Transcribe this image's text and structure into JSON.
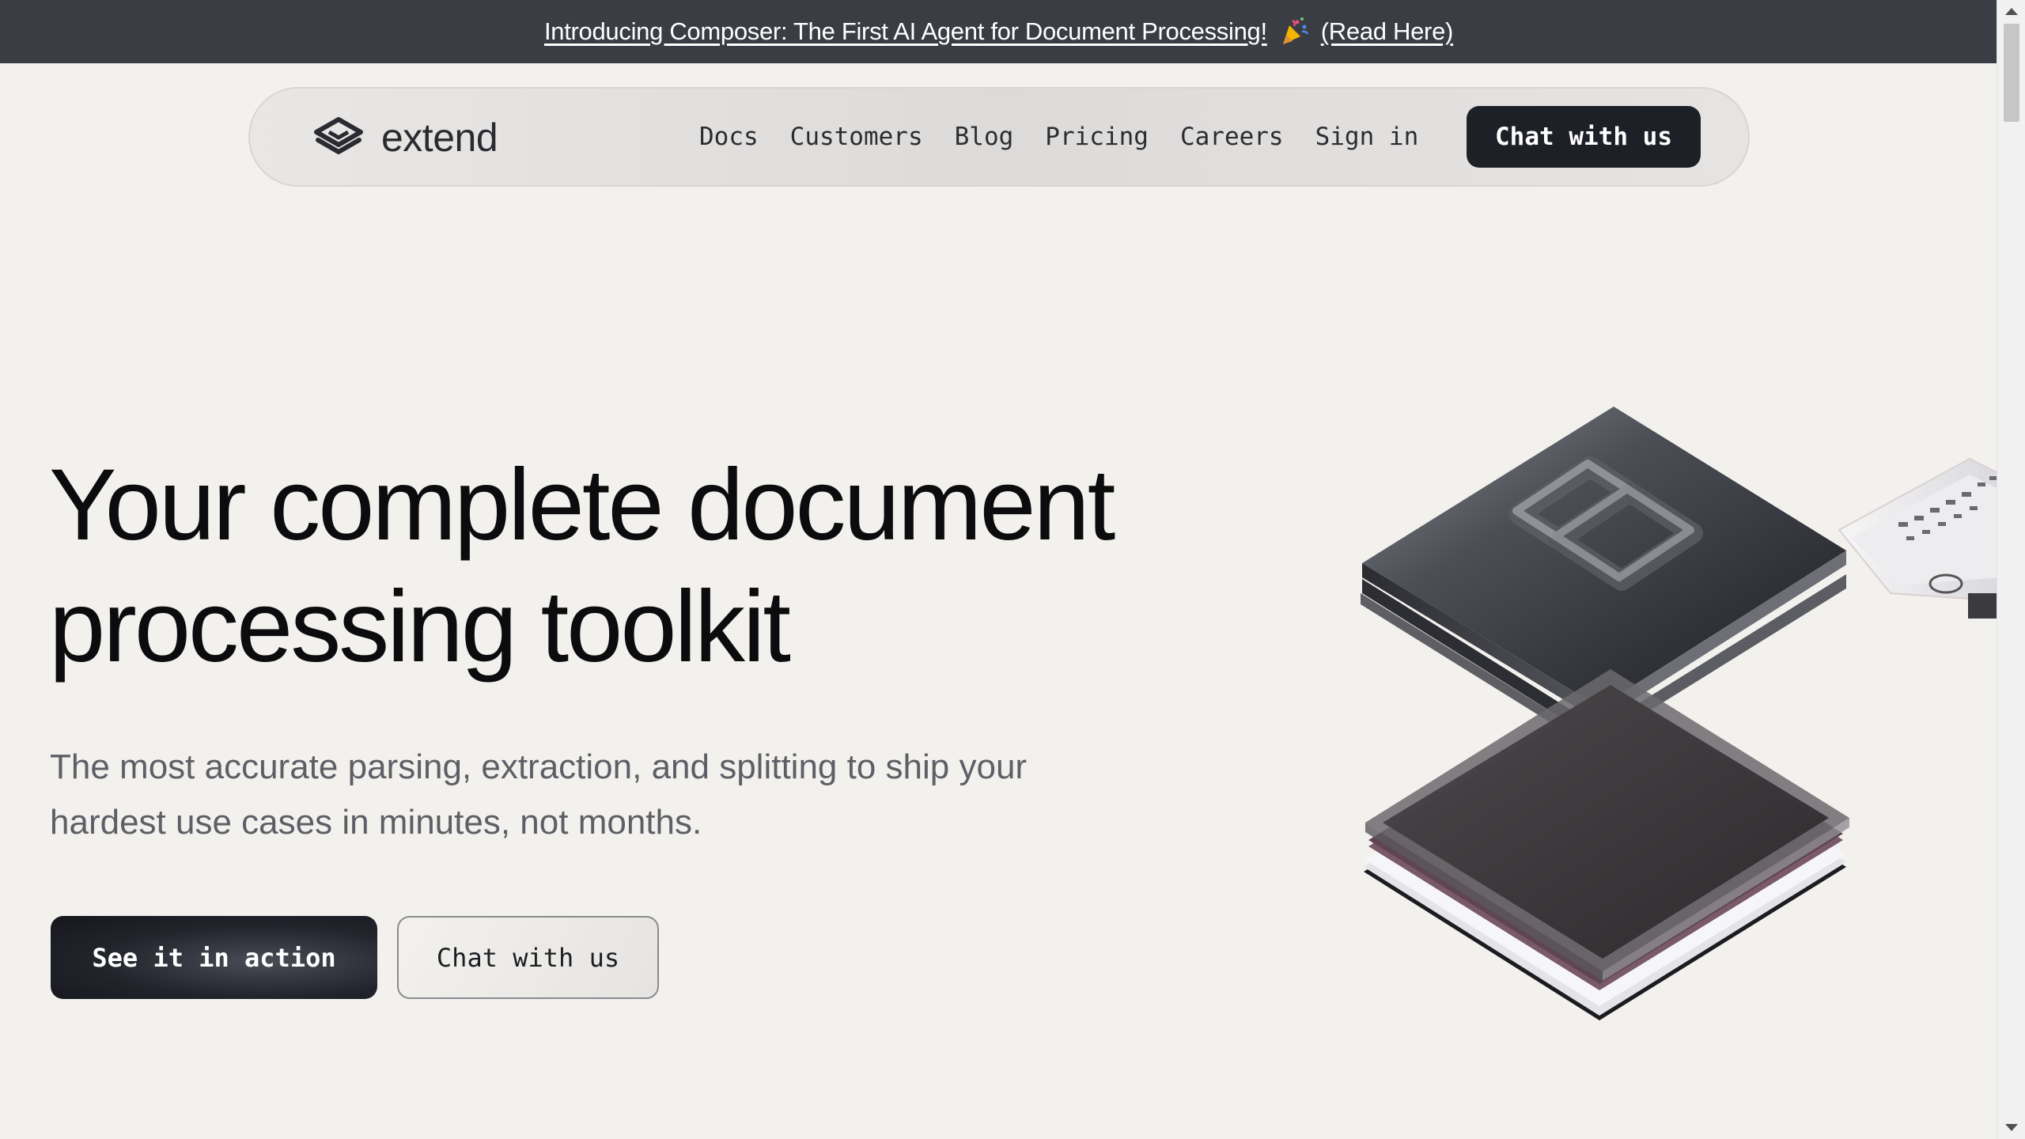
{
  "banner": {
    "text": "Introducing Composer: The First AI Agent for Document Processing!",
    "link_text": "(Read Here)",
    "emoji_icon": "party-popper-icon"
  },
  "nav": {
    "logo_text": "extend",
    "links": [
      "Docs",
      "Customers",
      "Blog",
      "Pricing",
      "Careers",
      "Sign in"
    ],
    "cta_label": "Chat with us"
  },
  "hero": {
    "title_line1": "Your complete document",
    "title_line2": "processing toolkit",
    "subtitle_line1": "The most accurate parsing, extraction, and splitting to ship your",
    "subtitle_line2": "hardest use cases in minutes, not months.",
    "primary_button": "See it in action",
    "secondary_button": "Chat with us"
  },
  "colors": {
    "background": "#f3f1ee",
    "banner": "#3b3d45",
    "dark_button": "#1e2028",
    "subtitle_text": "#5e5f66"
  }
}
